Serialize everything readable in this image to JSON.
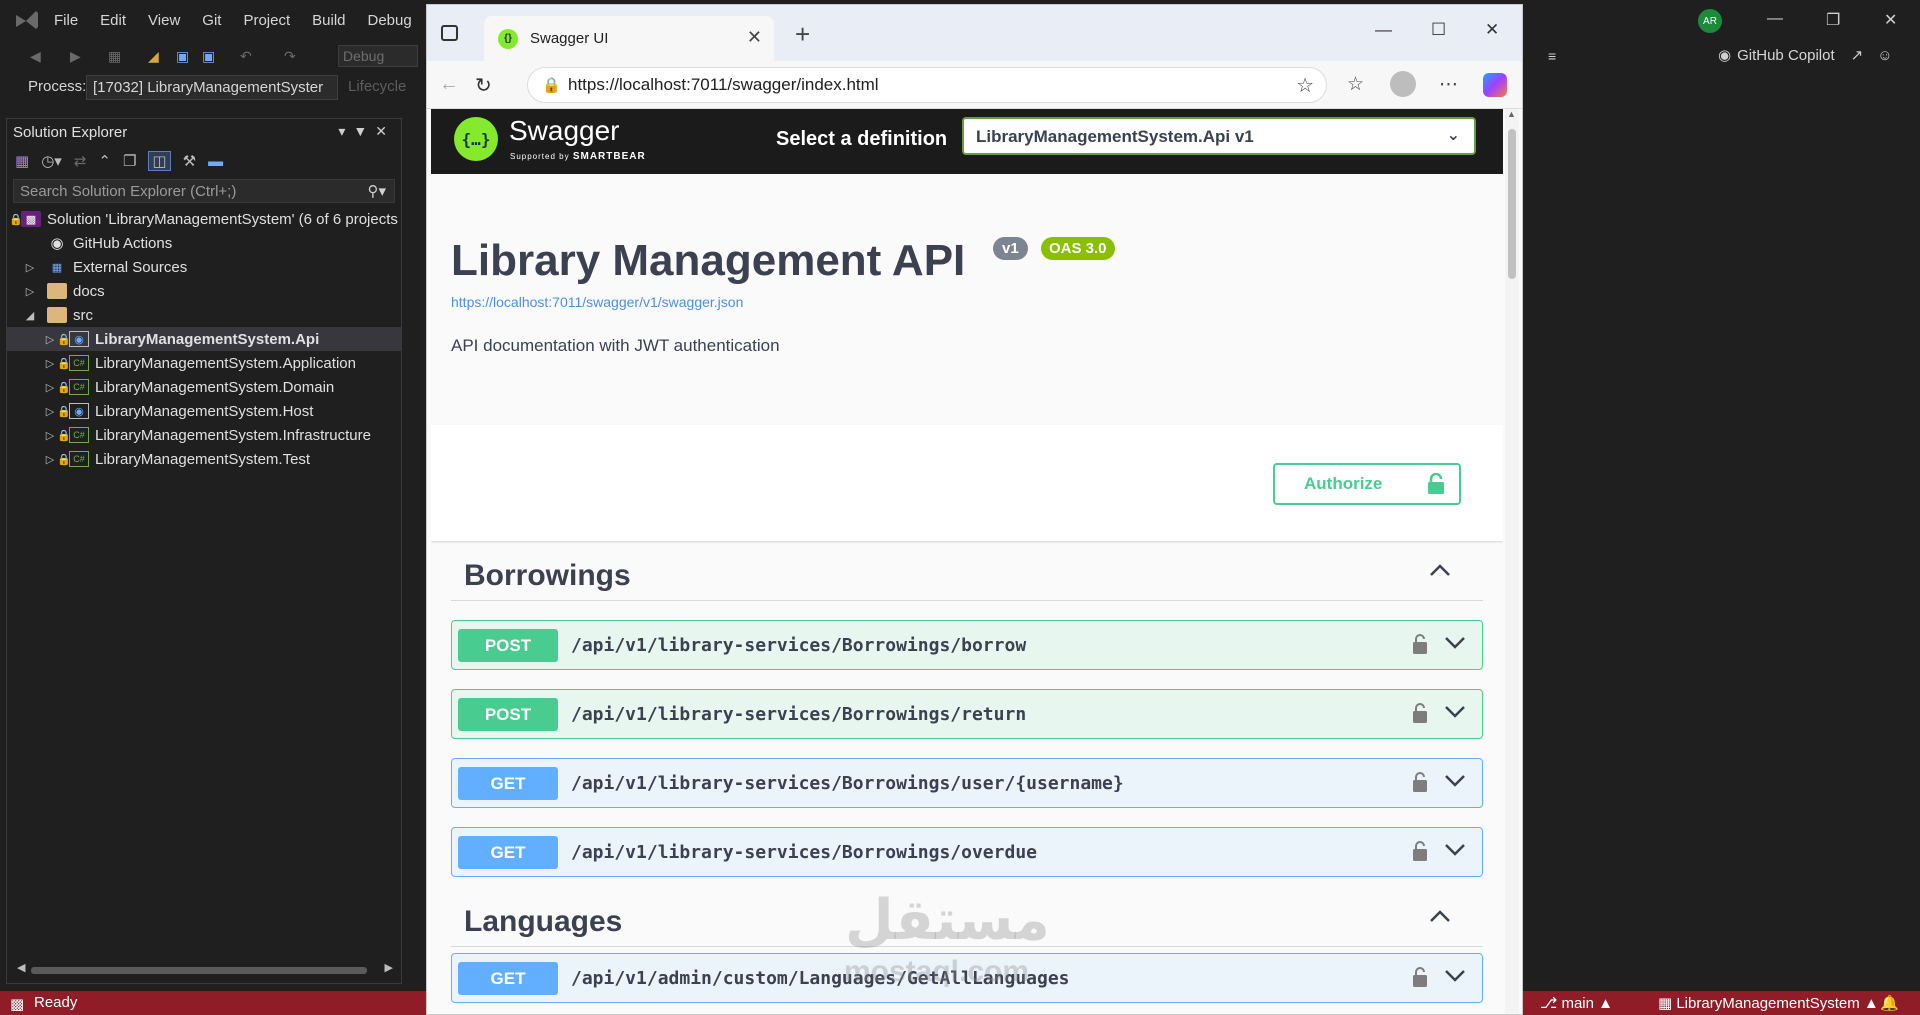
{
  "vs": {
    "menu": [
      "File",
      "Edit",
      "View",
      "Git",
      "Project",
      "Build",
      "Debug"
    ],
    "avatar_initials": "AR",
    "config": "Debug",
    "process_label": "Process:",
    "process_value": "[17032] LibraryManagementSyster",
    "lifecycle": "Lifecycle",
    "copilot": "GitHub Copilot"
  },
  "solution_explorer": {
    "title": "Solution Explorer",
    "search_placeholder": "Search Solution Explorer (Ctrl+;)",
    "items": [
      {
        "label": "Solution 'LibraryManagementSystem' (6 of 6 projects",
        "icon": "solution-icon"
      },
      {
        "label": "GitHub Actions",
        "icon": "github-icon"
      },
      {
        "label": "External Sources",
        "icon": "external-sources-icon"
      },
      {
        "label": "docs",
        "icon": "folder-icon"
      },
      {
        "label": "src",
        "icon": "folder-icon"
      },
      {
        "label": "LibraryManagementSystem.Api",
        "icon": "web-project-icon"
      },
      {
        "label": "LibraryManagementSystem.Application",
        "icon": "csharp-project-icon"
      },
      {
        "label": "LibraryManagementSystem.Domain",
        "icon": "csharp-project-icon"
      },
      {
        "label": "LibraryManagementSystem.Host",
        "icon": "web-project-icon"
      },
      {
        "label": "LibraryManagementSystem.Infrastructure",
        "icon": "csharp-project-icon"
      },
      {
        "label": "LibraryManagementSystem.Test",
        "icon": "csharp-project-icon"
      }
    ]
  },
  "status": {
    "ready": "Ready",
    "branch": "main",
    "project": "LibraryManagementSystem",
    "color": "#8f1c26"
  },
  "browser": {
    "tab_title": "Swagger UI",
    "url": "https://localhost:7011/swagger/index.html"
  },
  "swagger": {
    "brand": "Swagger",
    "supported_by": "Supported by",
    "smartbear": "SMARTBEAR",
    "select_label": "Select a definition",
    "definition": "LibraryManagementSystem.Api v1",
    "title": "Library Management API",
    "version_badge": "v1",
    "oas_badge": "OAS 3.0",
    "json_link": "https://localhost:7011/swagger/v1/swagger.json",
    "description": "API documentation with JWT authentication",
    "authorize": "Authorize",
    "sections": [
      {
        "name": "Borrowings",
        "ops": [
          {
            "method": "POST",
            "path": "/api/v1/library-services/Borrowings/borrow"
          },
          {
            "method": "POST",
            "path": "/api/v1/library-services/Borrowings/return"
          },
          {
            "method": "GET",
            "path": "/api/v1/library-services/Borrowings/user/{username}"
          },
          {
            "method": "GET",
            "path": "/api/v1/library-services/Borrowings/overdue"
          }
        ]
      },
      {
        "name": "Languages",
        "ops": [
          {
            "method": "GET",
            "path": "/api/v1/admin/custom/Languages/GetAllLanguages"
          }
        ]
      }
    ],
    "colors": {
      "post": "#49cc90",
      "get": "#61affe",
      "accent": "#85ea2d"
    }
  },
  "watermark": {
    "arabic": "مستقل",
    "latin": "mostaql.com"
  }
}
